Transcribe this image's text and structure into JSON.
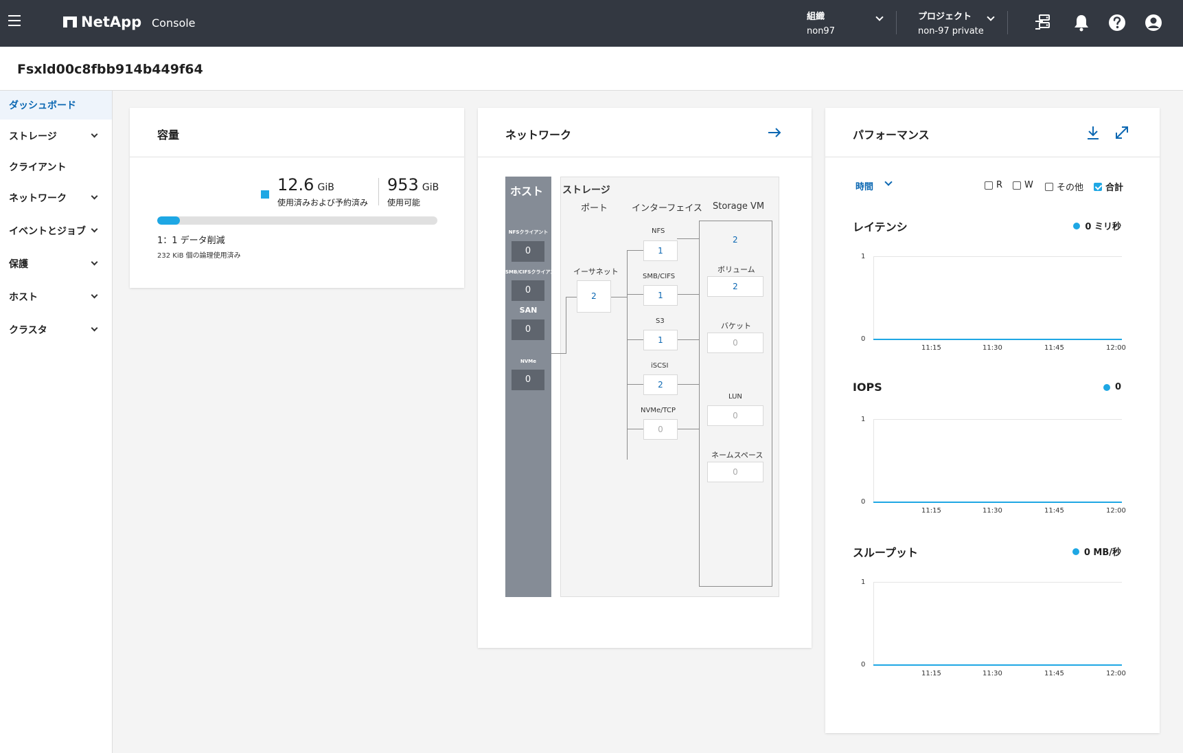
{
  "topbar": {
    "brand": "NetApp",
    "product": "Console",
    "org_label": "組織",
    "org_value": "non97",
    "project_label": "プロジェクト",
    "project_value": "non-97 private"
  },
  "page": {
    "title": "Fsxld00c8fbb914b449f64"
  },
  "sidebar": {
    "items": [
      {
        "label": "ダッシュボード"
      },
      {
        "label": "ストレージ"
      },
      {
        "label": "クライアント"
      },
      {
        "label": "ネットワーク"
      },
      {
        "label": "イベントとジョブ"
      },
      {
        "label": "保護"
      },
      {
        "label": "ホスト"
      },
      {
        "label": "クラスタ"
      }
    ]
  },
  "capacity": {
    "title": "容量",
    "used_value": "12.6",
    "used_unit": "GiB",
    "used_label": "使用済みおよび予約済み",
    "avail_value": "953",
    "avail_unit": "GiB",
    "avail_label": "使用可能",
    "used_fraction": 0.08,
    "dedup": "1：1 データ削減",
    "logical": "232 KiB 個の論理使用済み"
  },
  "network": {
    "title": "ネットワーク",
    "host_title": "ホスト",
    "host_labels": [
      "NFSクライアント",
      "SMB/CIFSクライアント",
      "SAN",
      "NVMe"
    ],
    "host_values": [
      "0",
      "0",
      "0",
      "0"
    ],
    "storage_title": "ストレージ",
    "col_port": "ポート",
    "col_interface": "インターフェイス",
    "col_svm": "Storage VM",
    "ethernet_label": "イーサネット",
    "ethernet_value": "2",
    "interfaces": [
      {
        "label": "NFS",
        "value": "1"
      },
      {
        "label": "SMB/CIFS",
        "value": "1"
      },
      {
        "label": "S3",
        "value": "1"
      },
      {
        "label": "iSCSI",
        "value": "2"
      },
      {
        "label": "NVMe/TCP",
        "value": "0"
      }
    ],
    "svm_value": "2",
    "svm_items": [
      {
        "label": "ボリューム",
        "value": "2"
      },
      {
        "label": "バケット",
        "value": "0"
      },
      {
        "label": "LUN",
        "value": "0"
      },
      {
        "label": "ネームスペース",
        "value": "0"
      }
    ]
  },
  "performance": {
    "title": "パフォーマンス",
    "time_label": "時間",
    "checkboxes": [
      {
        "label": "R",
        "checked": false
      },
      {
        "label": "W",
        "checked": false
      },
      {
        "label": "その他",
        "checked": false
      },
      {
        "label": "合計",
        "checked": true
      }
    ],
    "charts": [
      {
        "title": "レイテンシ",
        "legend": "0 ミリ秒"
      },
      {
        "title": "IOPS",
        "legend": "0"
      },
      {
        "title": "スループット",
        "legend": "0 MB/秒"
      }
    ],
    "y_ticks": [
      "1",
      "0"
    ],
    "x_ticks": [
      "11:15",
      "11:30",
      "11:45",
      "12:00"
    ]
  },
  "chart_data": [
    {
      "type": "line",
      "title": "レイテンシ",
      "x": [
        "11:15",
        "11:30",
        "11:45",
        "12:00"
      ],
      "series": [
        {
          "name": "0 ミリ秒",
          "values": [
            0,
            0,
            0,
            0
          ]
        }
      ],
      "ylim": [
        0,
        1
      ]
    },
    {
      "type": "line",
      "title": "IOPS",
      "x": [
        "11:15",
        "11:30",
        "11:45",
        "12:00"
      ],
      "series": [
        {
          "name": "0",
          "values": [
            0,
            0,
            0,
            0
          ]
        }
      ],
      "ylim": [
        0,
        1
      ]
    },
    {
      "type": "line",
      "title": "スループット",
      "x": [
        "11:15",
        "11:30",
        "11:45",
        "12:00"
      ],
      "series": [
        {
          "name": "0 MB/秒",
          "values": [
            0,
            0,
            0,
            0
          ]
        }
      ],
      "ylim": [
        0,
        1
      ]
    }
  ],
  "colors": {
    "topbar": "#333841",
    "accent": "#0b67b2",
    "series": "#1ea7e4",
    "host": "#858c96"
  }
}
